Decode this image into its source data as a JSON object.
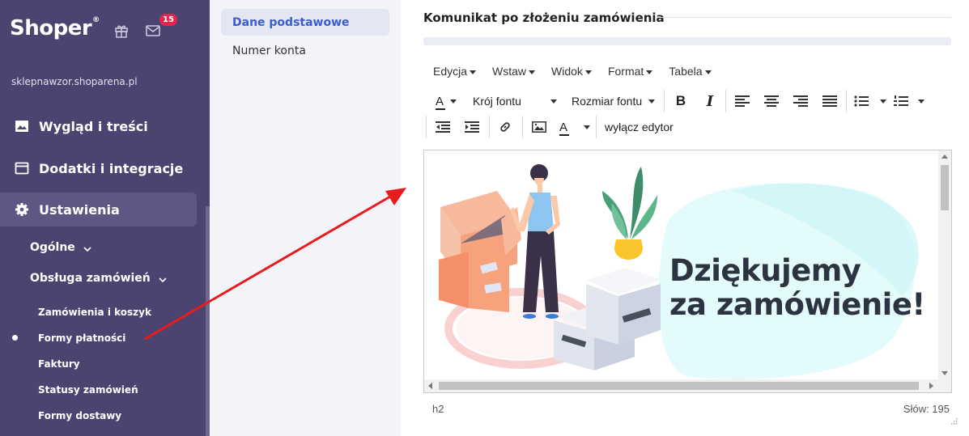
{
  "sidebar": {
    "logo": "Shoper",
    "logo_mark": "®",
    "notification_count": "15",
    "shop_url": "sklepnawzor.shoparena.pl",
    "items": [
      {
        "label": "Wygląd i treści",
        "icon": "image-icon"
      },
      {
        "label": "Dodatki i integracje",
        "icon": "browser-icon"
      },
      {
        "label": "Ustawienia",
        "icon": "gear-icon"
      }
    ],
    "sub_items": [
      {
        "label": "Ogólne"
      },
      {
        "label": "Obsługa zamówień"
      }
    ],
    "sub_sub_items": [
      {
        "label": "Zamówienia i koszyk"
      },
      {
        "label": "Formy płatności"
      },
      {
        "label": "Faktury"
      },
      {
        "label": "Statusy zamówień"
      },
      {
        "label": "Formy dostawy"
      }
    ]
  },
  "subnav": {
    "tabs": [
      {
        "label": "Dane podstawowe"
      },
      {
        "label": "Numer konta"
      }
    ]
  },
  "editor": {
    "section_title": "Komunikat po złożeniu zamówienia",
    "menubar": [
      "Edycja",
      "Wstaw",
      "Widok",
      "Format",
      "Tabela"
    ],
    "font_family_label": "Krój fontu",
    "font_size_label": "Rozmiar fontu",
    "disable_editor_label": "wyłącz edytor",
    "bold_label": "B",
    "italic_label": "I",
    "font_color_glyph": "A",
    "content_line1": "Dziękujemy",
    "content_line2": "za zamówienie!",
    "status_element": "h2",
    "word_count": "Słów: 195"
  },
  "colors": {
    "sidebar_bg": "#4b4470",
    "accent": "#3a5ccc",
    "badge": "#e5264a",
    "annotation_arrow": "#e81c1c"
  }
}
